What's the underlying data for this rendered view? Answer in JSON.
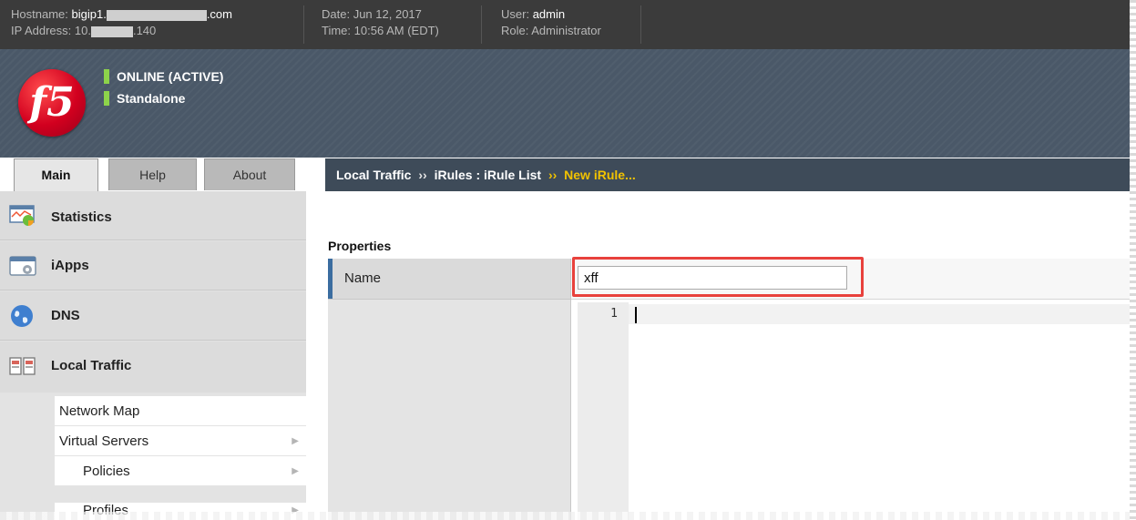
{
  "topbar": {
    "hostname_label": "Hostname:",
    "hostname_prefix": "bigip1.",
    "hostname_suffix": ".com",
    "ip_label": "IP Address:",
    "ip_prefix": "10.",
    "ip_suffix": ".140",
    "date_label": "Date:",
    "date_value": "Jun 12, 2017",
    "time_label": "Time:",
    "time_value": "10:56 AM (EDT)",
    "user_label": "User:",
    "user_value": "admin",
    "role_label": "Role:",
    "role_value": "Administrator"
  },
  "banner": {
    "logo_text": "f5",
    "status_line1": "ONLINE (ACTIVE)",
    "status_line2": "Standalone",
    "status_color": "#8dd34a"
  },
  "tabs": [
    {
      "label": "Main",
      "active": true
    },
    {
      "label": "Help",
      "active": false
    },
    {
      "label": "About",
      "active": false
    }
  ],
  "breadcrumb": {
    "part1": "Local Traffic",
    "sep1": "››",
    "part2": "iRules : iRule List",
    "sep2": "››",
    "current": "New iRule..."
  },
  "sidebar": {
    "sections": [
      {
        "label": "Statistics",
        "icon": "statistics-icon"
      },
      {
        "label": "iApps",
        "icon": "iapps-icon"
      },
      {
        "label": "DNS",
        "icon": "dns-globe-icon"
      },
      {
        "label": "Local Traffic",
        "icon": "local-traffic-icon"
      }
    ],
    "local_traffic_items": [
      {
        "label": "Network Map",
        "has_submenu": false
      },
      {
        "label": "Virtual Servers",
        "has_submenu": true
      },
      {
        "label": "Policies",
        "has_submenu": true
      },
      {
        "label": "Profiles",
        "has_submenu": true
      }
    ]
  },
  "content": {
    "section_title": "Properties",
    "name_label": "Name",
    "name_value": "xff",
    "definition_line_number": "1"
  },
  "colors": {
    "accent_blue": "#3b6da0",
    "highlight_red": "#e8413c",
    "breadcrumb_current": "#f2c200"
  }
}
